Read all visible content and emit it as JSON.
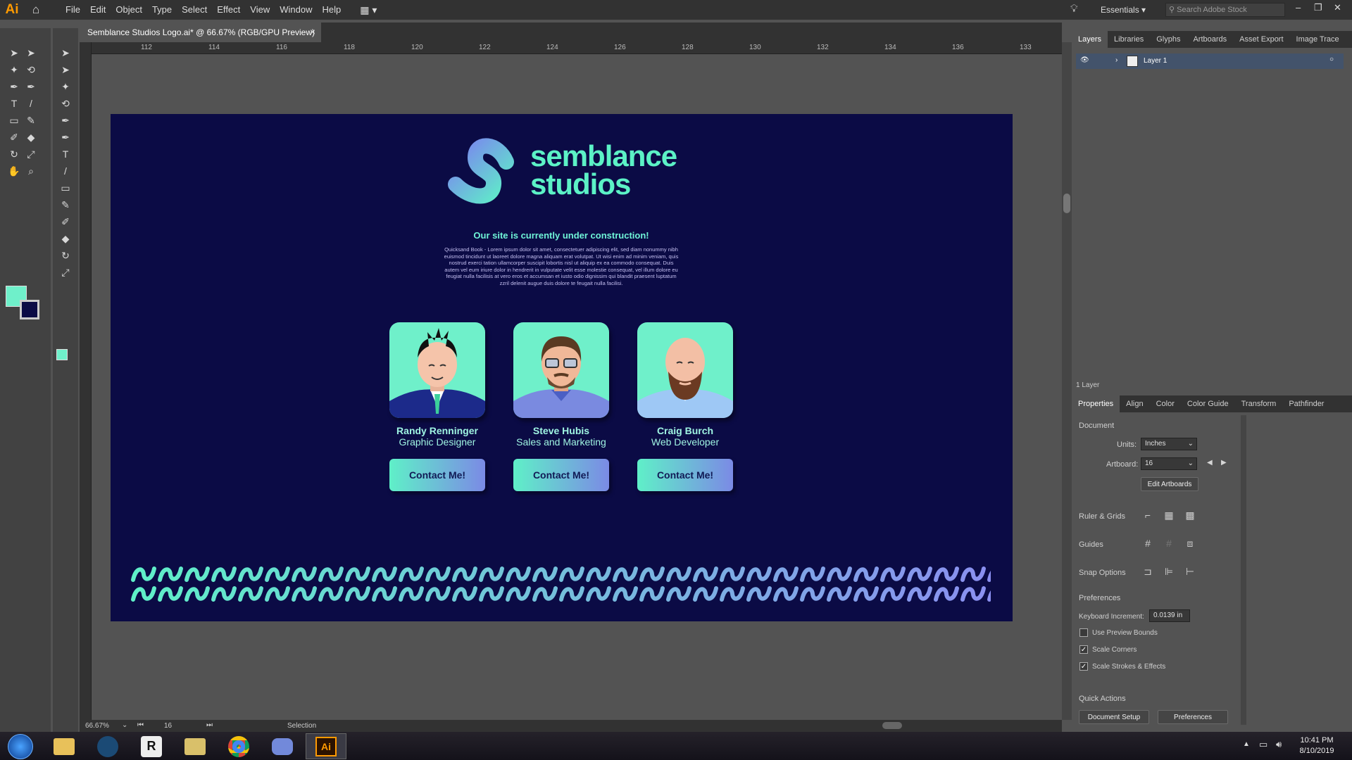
{
  "app": {
    "logo": "Ai",
    "menus": [
      "File",
      "Edit",
      "Object",
      "Type",
      "Select",
      "Effect",
      "View",
      "Window",
      "Help"
    ],
    "workspace": "Essentials",
    "search_placeholder": "Search Adobe Stock"
  },
  "document": {
    "tab_title": "Semblance Studios Logo.ai* @ 66.67% (RGB/GPU Preview)"
  },
  "ruler": {
    "marks": [
      "112",
      "114",
      "116",
      "118",
      "120",
      "122",
      "124",
      "126",
      "128",
      "130",
      "132",
      "134",
      "136",
      "133"
    ]
  },
  "artboard": {
    "logo_line1": "semblance",
    "logo_line2": "studios",
    "headline": "Our site is currently under construction!",
    "body": "Quicksand Book - Lorem ipsum dolor sit amet, consectetuer adipiscing elit, sed diam nonummy nibh euismod tincidunt ut laoreet dolore magna aliquam erat volutpat. Ut wisi enim ad minim veniam, quis nostrud exerci tation ullamcorper suscipit lobortis nisl ut aliquip ex ea commodo consequat. Duis autem vel eum iriure dolor in hendrerit in vulputate velit esse molestie consequat, vel illum dolore eu feugiat nulla facilisis at vero eros et accumsan et iusto odio dignissim qui blandit praesent luptatum zzril delenit augue duis dolore te feugait nulla facilisi.",
    "team": [
      {
        "name": "Randy Renninger",
        "role": "Graphic Designer",
        "button": "Contact Me!"
      },
      {
        "name": "Steve Hubis",
        "role": "Sales and Marketing",
        "button": "Contact Me!"
      },
      {
        "name": "Craig Burch",
        "role": "Web Developer",
        "button": "Contact Me!"
      }
    ]
  },
  "panels": {
    "top_tabs": [
      "Layers",
      "Libraries",
      "Glyphs",
      "Artboards",
      "Asset Export",
      "Image Trace"
    ],
    "layer_name": "Layer 1",
    "layer_count": "1 Layer",
    "bottom_tabs": [
      "Properties",
      "Align",
      "Color",
      "Color Guide",
      "Transform",
      "Pathfinder"
    ],
    "document_label": "Document",
    "units_label": "Units:",
    "units_value": "Inches",
    "artboard_label": "Artboard:",
    "artboard_value": "16",
    "edit_artboards": "Edit Artboards",
    "ruler_grids": "Ruler & Grids",
    "guides": "Guides",
    "snap_options": "Snap Options",
    "preferences_label": "Preferences",
    "keyboard_increment_label": "Keyboard Increment:",
    "keyboard_increment_value": "0.0139 in",
    "use_preview_bounds": "Use Preview Bounds",
    "scale_corners": "Scale Corners",
    "scale_strokes": "Scale Strokes & Effects",
    "quick_actions": "Quick Actions",
    "document_setup": "Document Setup",
    "preferences_button": "Preferences"
  },
  "status": {
    "zoom": "66.67%",
    "artboard_num": "16",
    "mode": "Selection"
  },
  "taskbar": {
    "time": "10:41 PM",
    "date": "8/10/2019"
  },
  "colors": {
    "accent": "#5cf2c6",
    "artboard_bg": "#0b0b45",
    "ai_orange": "#ff9a00"
  }
}
